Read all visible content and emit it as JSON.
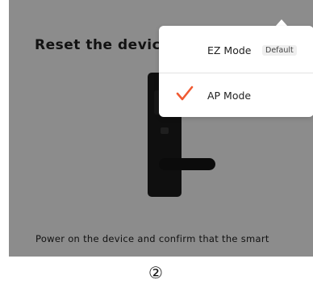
{
  "screen": {
    "title": "Reset the device",
    "instruction_line1": "Power on the device and confirm that the smart",
    "instruction_line2": "…"
  },
  "mode_menu": {
    "ez_mode": {
      "label": "EZ Mode",
      "badge": "Default"
    },
    "ap_mode": {
      "label": "AP Mode",
      "selected": true,
      "check_icon": "checkmark-icon"
    },
    "accent_color": "#f05a32"
  },
  "step": {
    "number": "②"
  },
  "colors": {
    "overlay": "rgba(0,0,0,0.45)",
    "popup_background": "#ffffff",
    "device_body": "#1c1c1c"
  }
}
